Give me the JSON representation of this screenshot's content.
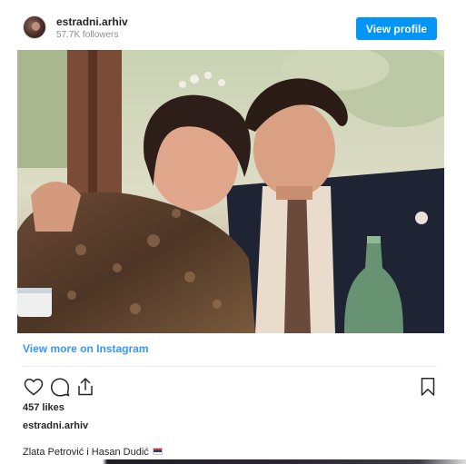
{
  "header": {
    "username": "estradni.arhiv",
    "followers": "57.7K followers",
    "view_profile_label": "View profile"
  },
  "photo": {
    "description_alt": ""
  },
  "footer": {
    "view_more_label": "View more on Instagram",
    "likes": "457 likes",
    "author": "estradni.arhiv",
    "caption": "Zlata Petrović i Hasan Dudić"
  },
  "icons": {
    "like": "heart-icon",
    "comment": "comment-icon",
    "share": "share-icon",
    "save": "bookmark-icon"
  },
  "colors": {
    "accent": "#0095f6",
    "link": "#3897f0",
    "text": "#262626",
    "muted": "#8e8e8e"
  }
}
